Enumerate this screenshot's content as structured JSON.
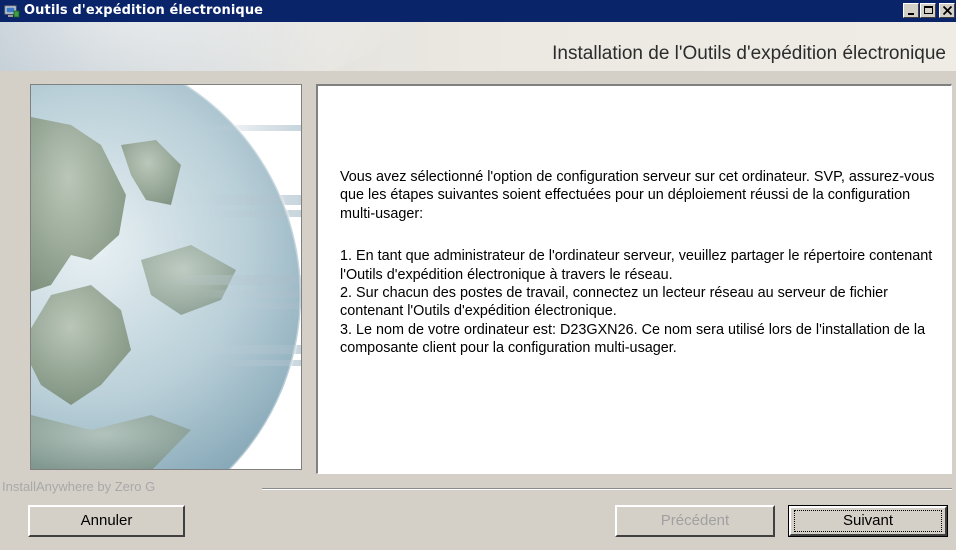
{
  "window": {
    "title": "Outils d'expédition électronique",
    "icon": "application-icon",
    "controls": {
      "minimize": "minimize-icon",
      "maximize": "maximize-icon",
      "close": "close-icon"
    }
  },
  "header": {
    "title": "Installation de l'Outils d'expédition électronique"
  },
  "content": {
    "paragraphs": [
      "Vous avez sélectionné l'option de configuration serveur sur cet ordinateur. SVP, assurez-vous que les étapes suivantes soient effectuées pour un déploiement réussi de la configuration multi-usager:",
      "1.  En tant que administrateur de l'ordinateur serveur, veuillez partager le répertoire contenant l'Outils d'expédition électronique à travers le réseau.",
      "2.  Sur chacun des postes de travail, connectez un lecteur réseau au serveur de fichier contenant l'Outils d'expédition électronique.",
      "3.  Le nom de votre ordinateur est: D23GXN26. Ce nom sera utilisé lors de l'installation de la composante client pour la configuration multi-usager."
    ]
  },
  "footer": {
    "brand": "InstallAnywhere by Zero G"
  },
  "buttons": {
    "cancel": "Annuler",
    "previous": "Précédent",
    "next": "Suivant"
  },
  "colors": {
    "titlebar": "#0a246a",
    "window_bg": "#d4d0c8",
    "disabled_text": "#a0a0a0"
  }
}
